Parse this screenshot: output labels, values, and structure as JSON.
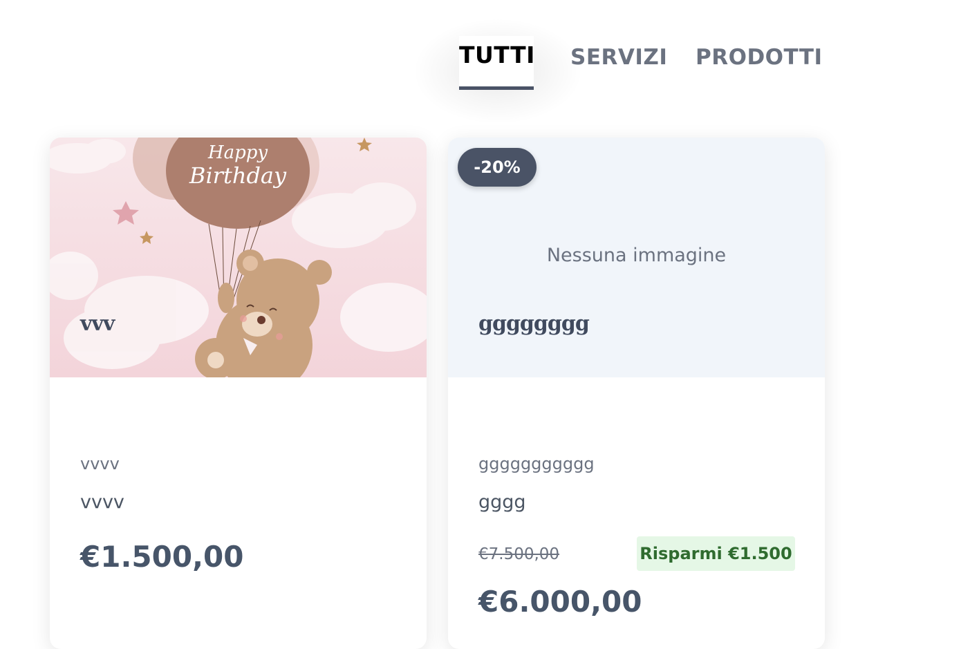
{
  "tabs": [
    {
      "label": "TUTTI",
      "active": true
    },
    {
      "label": "SERVIZI",
      "active": false
    },
    {
      "label": "PRODOTTI",
      "active": false
    }
  ],
  "products": [
    {
      "image": "happy-birthday-teddy-bear-balloons",
      "image_text": "Happy Birthday",
      "title": "vvv",
      "subtitle": "vvvv",
      "description": "vvvv",
      "price": "€1.500,00"
    },
    {
      "discount_badge": "-20%",
      "no_image_text": "Nessuna immagine",
      "title": "gggggggg",
      "subtitle": "ggggggggggg",
      "description": "gggg",
      "old_price": "€7.500,00",
      "savings": "Risparmi €1.500",
      "price": "€6.000,00"
    }
  ],
  "colors": {
    "accent": "#4a5366",
    "savings_bg": "#e5f7e6",
    "savings_text": "#2f6b2f",
    "placeholder_bg": "#f1f5fa"
  }
}
